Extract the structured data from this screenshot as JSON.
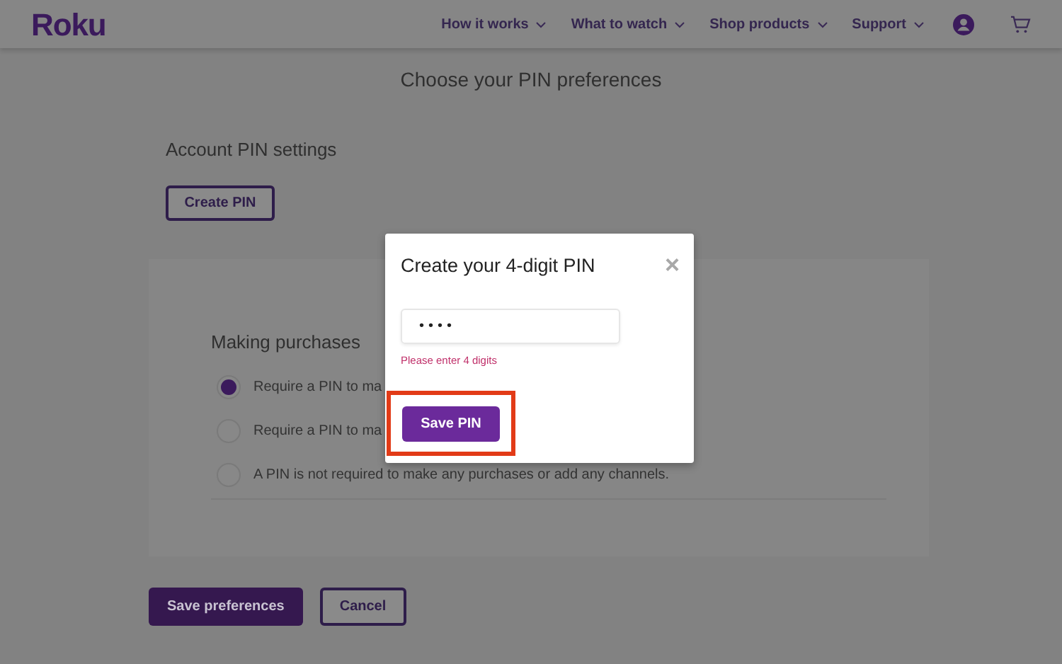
{
  "header": {
    "logo": "Roku",
    "nav": [
      {
        "label": "How it works"
      },
      {
        "label": "What to watch"
      },
      {
        "label": "Shop products"
      },
      {
        "label": "Support"
      }
    ]
  },
  "page_title": "Choose your PIN preferences",
  "account_section": {
    "heading": "Account PIN settings",
    "button": "Create PIN"
  },
  "purchases": {
    "heading": "Making purchases",
    "options": [
      {
        "label": "Require a PIN to ma",
        "selected": true
      },
      {
        "label": "Require a PIN to ma",
        "selected": false
      },
      {
        "label": "A PIN is not required to make any purchases or add any channels.",
        "selected": false
      }
    ]
  },
  "footer_buttons": [
    {
      "label": "Save preferences",
      "kind": "primary"
    },
    {
      "label": "Cancel",
      "kind": "secondary"
    }
  ],
  "modal": {
    "title": "Create your 4-digit PIN",
    "close": "×",
    "pin_value": "••••",
    "error": "Please enter 4 digits",
    "button": "Save PIN",
    "highlighted": true
  }
}
